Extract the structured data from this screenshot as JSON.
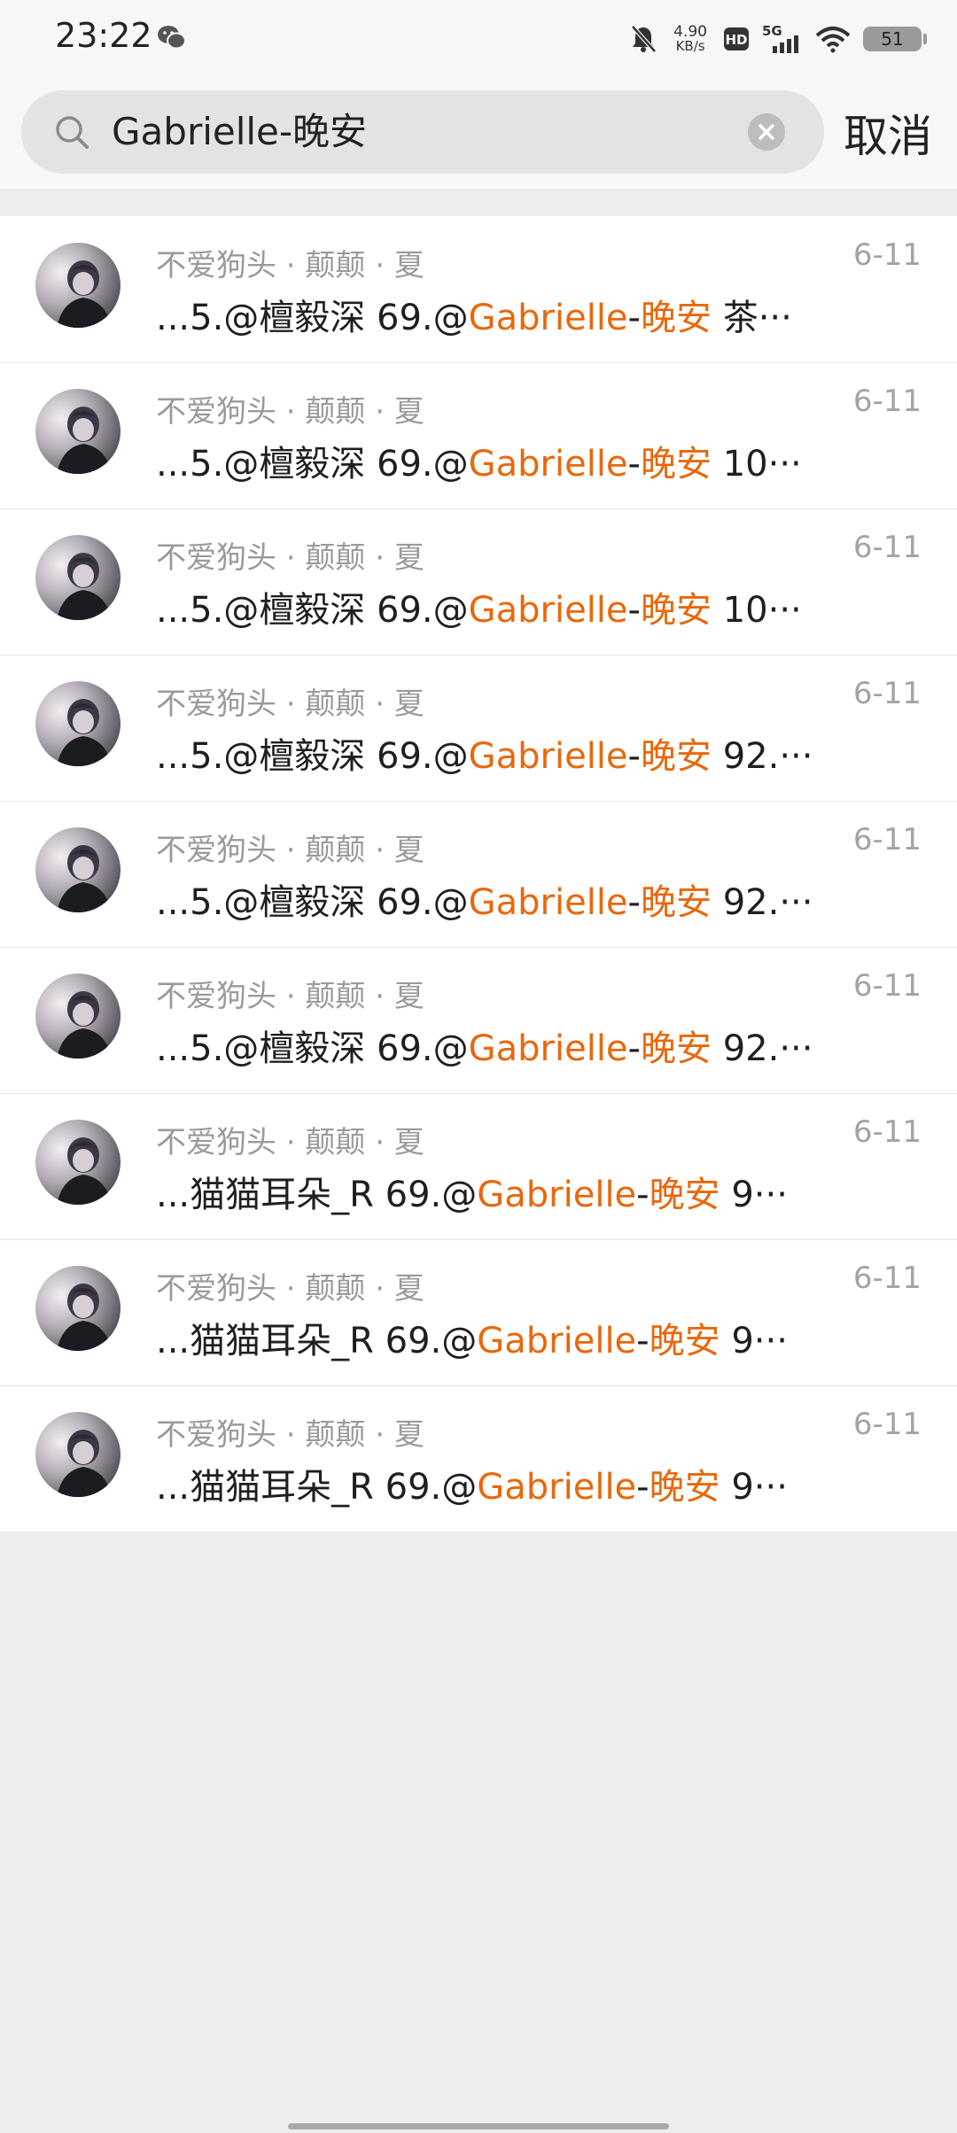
{
  "status_bar": {
    "time": "23:22",
    "net_speed_value": "4.90",
    "net_speed_unit": "KB/s",
    "hd_label": "HD",
    "network": "5G",
    "battery": "51",
    "icons": [
      "wechat-icon",
      "mute-icon",
      "hd-icon",
      "signal-icon",
      "wifi-icon",
      "battery-icon"
    ]
  },
  "search": {
    "query": "Gabrielle-晚安",
    "cancel_label": "取消"
  },
  "colors": {
    "highlight": "#e8680c",
    "background": "#ededed"
  },
  "results": [
    {
      "name": "不爱狗头 · 颠颠 · 夏",
      "date": "6-11",
      "prefix": "...5.@檀毅深 69.@",
      "hl1": "Gabrielle",
      "sep": "-",
      "hl2": "晚安",
      "suffix": " 茶···"
    },
    {
      "name": "不爱狗头 · 颠颠 · 夏",
      "date": "6-11",
      "prefix": "...5.@檀毅深 69.@",
      "hl1": "Gabrielle",
      "sep": "-",
      "hl2": "晚安",
      "suffix": " 10···"
    },
    {
      "name": "不爱狗头 · 颠颠 · 夏",
      "date": "6-11",
      "prefix": "...5.@檀毅深 69.@",
      "hl1": "Gabrielle",
      "sep": "-",
      "hl2": "晚安",
      "suffix": " 10···"
    },
    {
      "name": "不爱狗头 · 颠颠 · 夏",
      "date": "6-11",
      "prefix": "...5.@檀毅深 69.@",
      "hl1": "Gabrielle",
      "sep": "-",
      "hl2": "晚安",
      "suffix": " 92.···"
    },
    {
      "name": "不爱狗头 · 颠颠 · 夏",
      "date": "6-11",
      "prefix": "...5.@檀毅深 69.@",
      "hl1": "Gabrielle",
      "sep": "-",
      "hl2": "晚安",
      "suffix": " 92.···"
    },
    {
      "name": "不爱狗头 · 颠颠 · 夏",
      "date": "6-11",
      "prefix": "...5.@檀毅深 69.@",
      "hl1": "Gabrielle",
      "sep": "-",
      "hl2": "晚安",
      "suffix": " 92.···"
    },
    {
      "name": "不爱狗头 · 颠颠 · 夏",
      "date": "6-11",
      "prefix": "...猫猫耳朵_R 69.@",
      "hl1": "Gabrielle",
      "sep": "-",
      "hl2": "晚安",
      "suffix": " 9···"
    },
    {
      "name": "不爱狗头 · 颠颠 · 夏",
      "date": "6-11",
      "prefix": "...猫猫耳朵_R 69.@",
      "hl1": "Gabrielle",
      "sep": "-",
      "hl2": "晚安",
      "suffix": " 9···"
    },
    {
      "name": "不爱狗头 · 颠颠 · 夏",
      "date": "6-11",
      "prefix": "...猫猫耳朵_R 69.@",
      "hl1": "Gabrielle",
      "sep": "-",
      "hl2": "晚安",
      "suffix": " 9···"
    }
  ]
}
